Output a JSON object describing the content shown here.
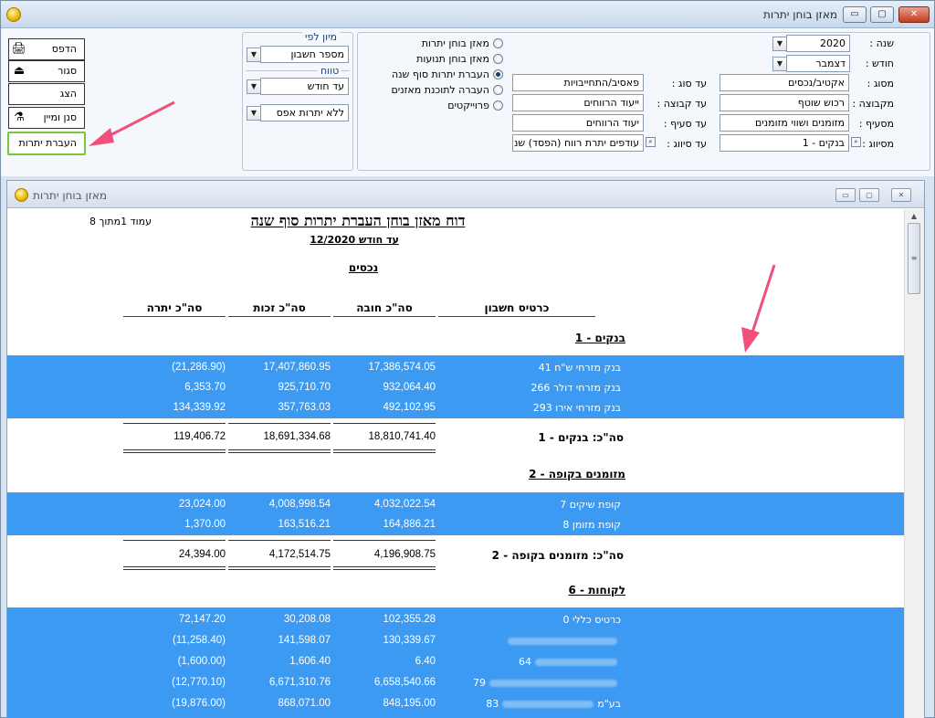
{
  "window": {
    "title": "מאזן בוחן יתרות",
    "close_icon": "✕",
    "maximize_icon": "▢",
    "minimize_icon": "▭"
  },
  "filters": {
    "year_label": "שנה :",
    "year_value": "2020",
    "month_label": "חודש :",
    "month_value": "דצמבר",
    "type_label": "מסוג :",
    "type_value": "אקטיב/נכסים",
    "type_to_label": "עד סוג :",
    "type_to_value": "פאסיב/התחייבויות",
    "group_label": "מקבוצה :",
    "group_value": "רכוש שוטף",
    "group_to_label": "עד קבוצה :",
    "group_to_value": "ייעוד הרווחים",
    "section_label": "מסעיף :",
    "section_value": "מזומנים ושווי מזומנים",
    "section_to_label": "עד סעיף :",
    "section_to_value": "יעוד הרווחים",
    "class_label": "מסיווג :",
    "class_value": "בנקים - 1",
    "class_to_label": "עד סיווג :",
    "class_to_value": "עודפים יתרת רווח (הפסד) שנ"
  },
  "report_type": {
    "options": [
      {
        "label": "מאזן בוחן יתרות",
        "selected": false
      },
      {
        "label": "מאזן בוחן תנועות",
        "selected": false
      },
      {
        "label": "העברת יתרות סוף שנה",
        "selected": true
      },
      {
        "label": "העברה לתוכנת מאזנים",
        "selected": false
      },
      {
        "label": "פרוייקטים",
        "selected": false
      }
    ]
  },
  "sort": {
    "title": "מיון לפי",
    "value": "מספר חשבון",
    "range_title": "טווח",
    "range_value": "עד חודש",
    "zero_value": "ללא יתרות אפס"
  },
  "actions": {
    "print": "הדפס",
    "close": "סגור",
    "show": "הצג",
    "filter_sort": "סנן ומיין",
    "transfer": "העברת יתרות"
  },
  "inner_window": {
    "title": "מאזן בוחן יתרות"
  },
  "report": {
    "title": "דוח מאזן בוחן העברת יתרות סוף שנה",
    "subtitle": "עד חודש 12/2020",
    "page": "עמוד 1מתוך 8",
    "section": "נכסים",
    "columns": {
      "account": "כרטיס חשבון",
      "debit": "סה\"כ חובה",
      "credit": "סה\"כ זכות",
      "balance": "סה\"כ יתרה"
    },
    "groups": [
      {
        "title": "בנקים - 1",
        "rows": [
          {
            "account": "בנק מזרחי ש\"ח",
            "num": "41",
            "debit": "17,386,574.05",
            "credit": "17,407,860.95",
            "balance": "(21,286.90)"
          },
          {
            "account": "בנק מזרחי דולר",
            "num": "266",
            "debit": "932,064.40",
            "credit": "925,710.70",
            "balance": "6,353.70"
          },
          {
            "account": "בנק מזרחי אירו",
            "num": "293",
            "debit": "492,102.95",
            "credit": "357,763.03",
            "balance": "134,339.92"
          }
        ],
        "total_label": "סה\"כ: בנקים - 1",
        "total_debit": "18,810,741.40",
        "total_credit": "18,691,334.68",
        "total_balance": "119,406.72"
      },
      {
        "title": "מזומנים בקופה - 2",
        "rows": [
          {
            "account": "קופת שיקים",
            "num": "7",
            "debit": "4,032,022.54",
            "credit": "4,008,998.54",
            "balance": "23,024.00"
          },
          {
            "account": "קופת מזומן",
            "num": "8",
            "debit": "164,886.21",
            "credit": "163,516.21",
            "balance": "1,370.00"
          }
        ],
        "total_label": "סה\"כ: מזומנים בקופה - 2",
        "total_debit": "4,196,908.75",
        "total_credit": "4,172,514.75",
        "total_balance": "24,394.00"
      },
      {
        "title": "לקוחות - 6",
        "rows": [
          {
            "account": "כרטיס כללי",
            "num": "0",
            "debit": "102,355.28",
            "credit": "30,208.08",
            "balance": "72,147.20"
          },
          {
            "account": "",
            "num": "",
            "debit": "130,339.67",
            "credit": "141,598.07",
            "balance": "(11,258.40)"
          },
          {
            "account": "",
            "num": "64",
            "debit": "6.40",
            "credit": "1,606.40",
            "balance": "(1,600.00)"
          },
          {
            "account": "",
            "num": "79",
            "debit": "6,658,540.66",
            "credit": "6,671,310.76",
            "balance": "(12,770.10)"
          },
          {
            "account": "בע\"מ",
            "num": "83",
            "debit": "848,195.00",
            "credit": "868,071.00",
            "balance": "(19,876.00)"
          }
        ]
      }
    ]
  }
}
